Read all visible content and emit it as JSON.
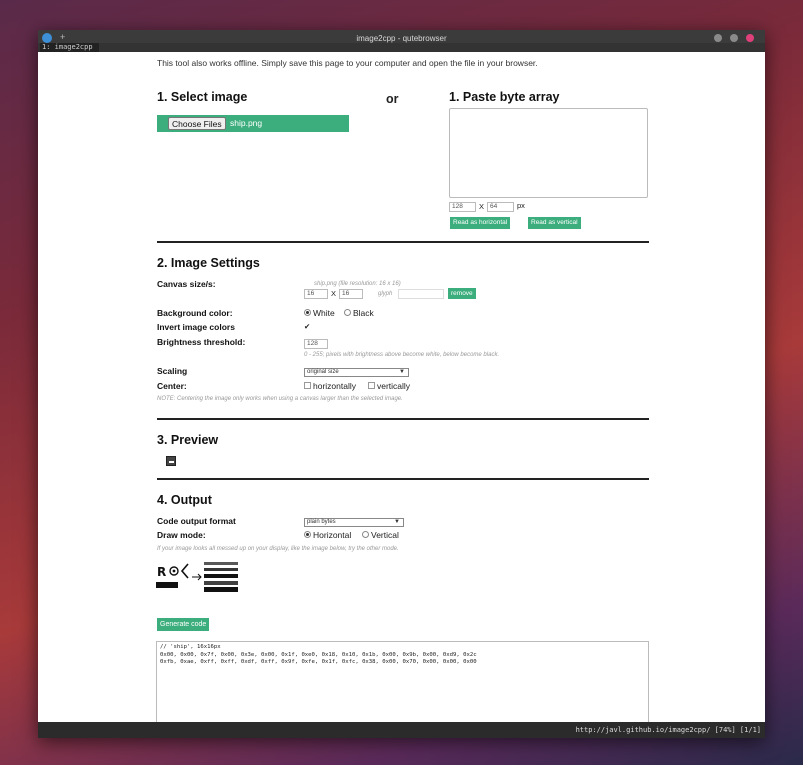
{
  "window": {
    "title": "image2cpp - qutebrowser",
    "tab_label": "1: image2cpp",
    "status_url": "http://javl.github.io/image2cpp/ [74%] [1/1]"
  },
  "intro_text": "This tool also works offline. Simply save this page to your computer and open the file in your browser.",
  "select_image": {
    "heading": "1. Select image",
    "choose_button": "Choose Files",
    "file_name": "ship.png"
  },
  "or_label": "or",
  "paste_bytes": {
    "heading": "1. Paste byte array",
    "textarea_value": "",
    "width": "128",
    "x_label": "X",
    "height": "64",
    "px_label": "px",
    "read_horizontal": "Read as horizontal",
    "read_vertical": "Read as vertical"
  },
  "image_settings": {
    "heading": "2. Image Settings",
    "canvas_label": "Canvas size/s:",
    "canvas_hint": "ship.png (file resolution: 16 x 16)",
    "canvas_w": "16",
    "canvas_x": "X",
    "canvas_h": "16",
    "glyph_label": "glyph",
    "glyph_value": "",
    "remove_button": "remove",
    "bg_label": "Background color:",
    "bg_white": "White",
    "bg_black": "Black",
    "invert_label": "Invert image colors",
    "invert_mark": "✔",
    "brightness_label": "Brightness threshold:",
    "brightness_value": "128",
    "brightness_hint": "0 - 255; pixels with brightness above become white, below become black.",
    "scaling_label": "Scaling",
    "scaling_value": "original size",
    "center_label": "Center:",
    "center_h": "horizontally",
    "center_v": "vertically",
    "note": "NOTE: Centering the image only works when using a canvas larger than the selected image."
  },
  "preview": {
    "heading": "3. Preview"
  },
  "output": {
    "heading": "4. Output",
    "format_label": "Code output format",
    "format_value": "plain bytes",
    "draw_mode_label": "Draw mode:",
    "draw_h": "Horizontal",
    "draw_v": "Vertical",
    "draw_hint": "If your image looks all messed up on your display, like the image below, try the other mode.",
    "generate_button": "Generate code",
    "code_lines": [
      "// 'ship', 16x16px",
      "0x00, 0x00, 0x7f, 0x00, 0x3e, 0x00, 0x1f, 0xe0, 0x18, 0x10, 0x1b, 0x00, 0x9b, 0x00, 0xd9, 0x2c",
      "0xfb, 0xae, 0xff, 0xff, 0xdf, 0xff, 0x9f, 0xfe, 0x1f, 0xfc, 0x38, 0x00, 0x70, 0x00, 0x00, 0x00"
    ]
  }
}
